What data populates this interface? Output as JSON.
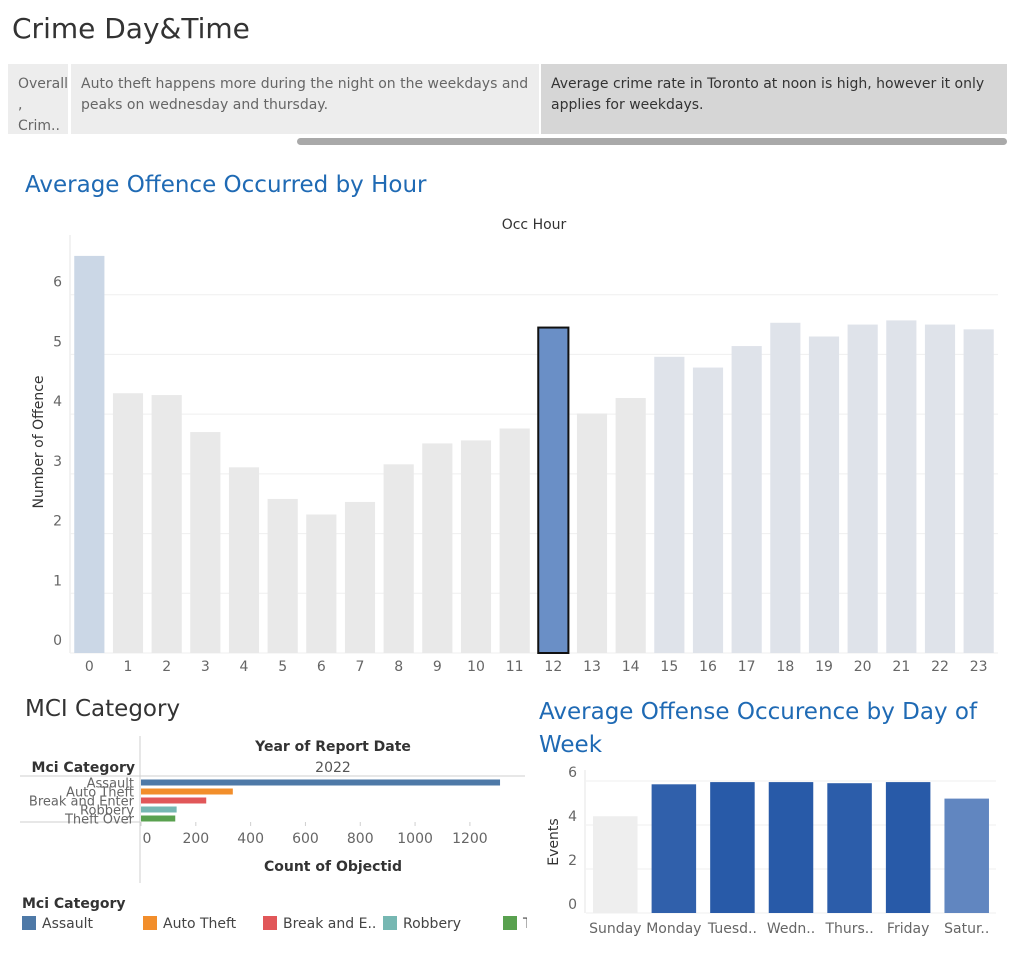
{
  "page_title": "Crime Day&Time",
  "story_points": [
    {
      "text": "Overall , Crim..",
      "active": false
    },
    {
      "text": "Auto theft  happens more during the night on the weekdays and peaks on wednesday and thursday.",
      "active": false
    },
    {
      "text": "Average crime rate in Toronto at noon is high, however it only applies for weekdays.",
      "active": true
    }
  ],
  "colors": {
    "title_blue": "#1f6ab4",
    "assault": "#4e79a7",
    "auto_theft": "#f28e2b",
    "break_and_enter": "#e15759",
    "robbery": "#76b7b2",
    "theft_over": "#59a14f"
  },
  "chart_data": [
    {
      "type": "bar",
      "title": "Average Offence Occurred by Hour",
      "column_header": "Occ Hour",
      "ylabel": "Number of Offence",
      "ylim": [
        0,
        7
      ],
      "yticks": [
        0,
        1,
        2,
        3,
        4,
        5,
        6
      ],
      "categories": [
        "0",
        "1",
        "2",
        "3",
        "4",
        "5",
        "6",
        "7",
        "8",
        "9",
        "10",
        "11",
        "12",
        "13",
        "14",
        "15",
        "16",
        "17",
        "18",
        "19",
        "20",
        "21",
        "22",
        "23"
      ],
      "values": [
        6.65,
        4.35,
        4.32,
        3.7,
        3.11,
        2.58,
        2.32,
        2.53,
        3.16,
        3.51,
        3.56,
        3.76,
        5.45,
        4.01,
        4.27,
        4.96,
        4.78,
        5.14,
        5.53,
        5.3,
        5.5,
        5.57,
        5.5,
        5.42
      ],
      "highlight_index": 12,
      "grid": true
    },
    {
      "type": "bar",
      "title": "MCI Category",
      "orientation": "horizontal",
      "column_header": "Year of Report Date",
      "column_value": "2022",
      "row_header": "Mci Category",
      "xlabel": "Count of Objectid",
      "xlim": [
        0,
        1350
      ],
      "xticks": [
        0,
        200,
        400,
        600,
        800,
        1000,
        1200
      ],
      "categories": [
        "Assault",
        "Auto Theft",
        "Break and Enter",
        "Robbery",
        "Theft Over"
      ],
      "values": [
        1310,
        335,
        238,
        130,
        125
      ],
      "legend": {
        "title": "Mci Category",
        "items": [
          "Assault",
          "Auto Theft",
          "Break and E..",
          "Robbery",
          "T"
        ]
      }
    },
    {
      "type": "bar",
      "title": "Average Offense Occurence by Day of Week",
      "ylabel": "Events",
      "ylim": [
        0,
        6.5
      ],
      "yticks": [
        0,
        2,
        4,
        6
      ],
      "categories": [
        "Sunday",
        "Monday",
        "Tuesd..",
        "Wedn..",
        "Thurs..",
        "Friday",
        "Satur.."
      ],
      "values": [
        4.4,
        5.85,
        5.95,
        5.95,
        5.9,
        5.95,
        5.2
      ],
      "grid": true
    }
  ]
}
